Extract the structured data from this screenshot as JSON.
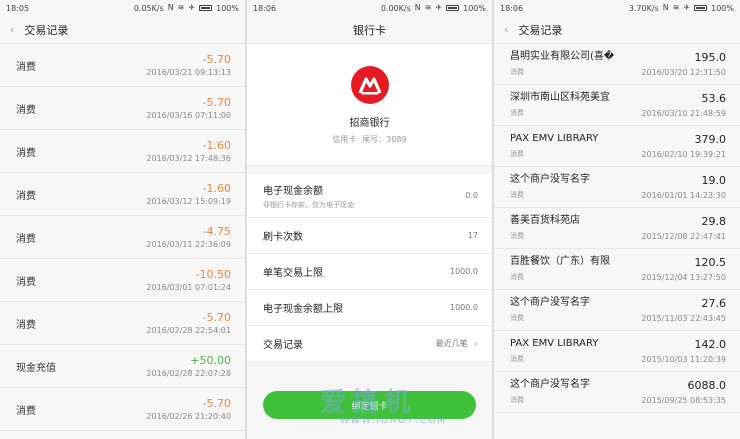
{
  "screen1": {
    "status": {
      "time": "18:05",
      "speed": "0.05K/s",
      "battery": "100%"
    },
    "title": "交易记录",
    "back_glyph": "‹",
    "rows": [
      {
        "label": "消费",
        "amount": "-5.70",
        "date": "2016/03/21 09:13:13",
        "kind": "neg"
      },
      {
        "label": "消费",
        "amount": "-5.70",
        "date": "2016/03/16 07:11:00",
        "kind": "neg"
      },
      {
        "label": "消费",
        "amount": "-1.60",
        "date": "2016/03/12 17:48:36",
        "kind": "neg"
      },
      {
        "label": "消费",
        "amount": "-1.60",
        "date": "2016/03/12 15:09:19",
        "kind": "neg"
      },
      {
        "label": "消费",
        "amount": "-4.75",
        "date": "2016/03/11 22:36:09",
        "kind": "neg"
      },
      {
        "label": "消费",
        "amount": "-10.50",
        "date": "2016/03/01 07:01:24",
        "kind": "neg"
      },
      {
        "label": "消费",
        "amount": "-5.70",
        "date": "2016/02/28 22:54:01",
        "kind": "neg"
      },
      {
        "label": "现金充值",
        "amount": "+50.00",
        "date": "2016/02/28 22:07:28",
        "kind": "pos"
      },
      {
        "label": "消费",
        "amount": "-5.70",
        "date": "2016/02/26 21:20:40",
        "kind": "neg"
      }
    ]
  },
  "screen2": {
    "status": {
      "time": "18:06",
      "speed": "0.00K/s",
      "battery": "100%"
    },
    "title": "银行卡",
    "bank_name": "招商银行",
    "card_type": "信用卡",
    "card_tail": "尾号：3089",
    "settings": [
      {
        "title": "电子现金余额",
        "subtitle": "非银行卡存款，仅为电子现金",
        "value": "0.0"
      },
      {
        "title": "刷卡次数",
        "subtitle": "",
        "value": "17"
      },
      {
        "title": "单笔交易上限",
        "subtitle": "",
        "value": "1000.0"
      },
      {
        "title": "电子现金余额上限",
        "subtitle": "",
        "value": "1000.0"
      },
      {
        "title": "交易记录",
        "subtitle": "",
        "value": "最近几笔"
      }
    ],
    "chevron": "›",
    "bind_button": "绑定银卡",
    "watermark_big": "爱搞机",
    "watermark_small": "WWW.IGAO7.COM"
  },
  "screen3": {
    "status": {
      "time": "18:06",
      "speed": "3.70K/s",
      "battery": "100%"
    },
    "title": "交易记录",
    "back_glyph": "‹",
    "rows": [
      {
        "name": "昌明实业有限公司(喜�",
        "type": "消费",
        "amount": "195.0",
        "date": "2016/03/20 12:31:50"
      },
      {
        "name": "深圳市南山区科苑美宜",
        "type": "消费",
        "amount": "53.6",
        "date": "2016/03/10 21:48:59"
      },
      {
        "name": "PAX EMV LIBRARY",
        "type": "消费",
        "amount": "379.0",
        "date": "2016/02/10 19:39:21"
      },
      {
        "name": "这个商户没写名字",
        "type": "消费",
        "amount": "19.0",
        "date": "2016/01/01 14:23:30"
      },
      {
        "name": "善美百货科苑店",
        "type": "消费",
        "amount": "29.8",
        "date": "2015/12/08 22:47:41"
      },
      {
        "name": "百胜餐饮（广东）有限",
        "type": "消费",
        "amount": "120.5",
        "date": "2015/12/04 13:27:50"
      },
      {
        "name": "这个商户没写名字",
        "type": "消费",
        "amount": "27.6",
        "date": "2015/11/03 22:43:45"
      },
      {
        "name": "PAX EMV LIBRARY",
        "type": "消费",
        "amount": "142.0",
        "date": "2015/10/03 11:20:39"
      },
      {
        "name": "这个商户没写名字",
        "type": "消费",
        "amount": "6088.0",
        "date": "2015/09/25 08:53:35"
      }
    ]
  },
  "colors": {
    "negative": "#f0843c",
    "positive": "#4bb34b",
    "bank_red": "#e51b23",
    "button_green": "#3fc13a"
  }
}
